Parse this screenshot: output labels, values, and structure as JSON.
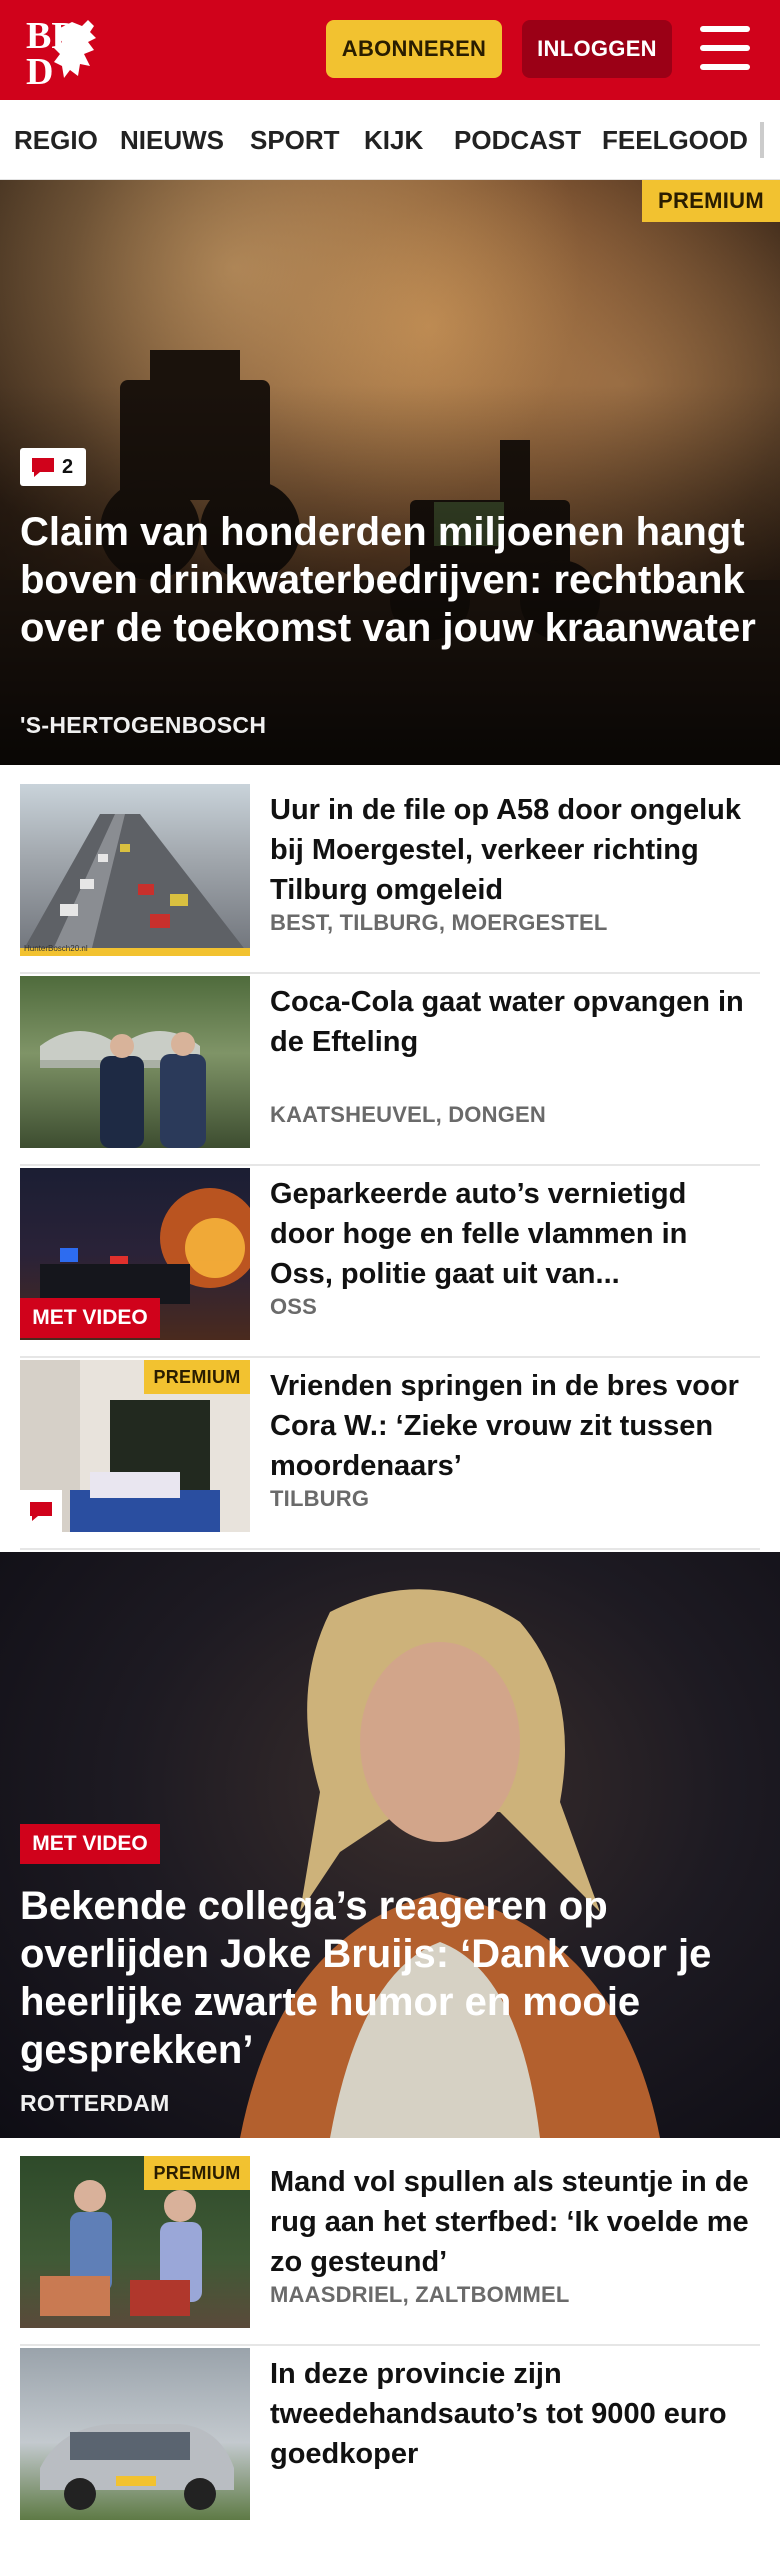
{
  "header": {
    "brand": "BD",
    "subscribe_label": "ABONNEREN",
    "login_label": "INLOGGEN"
  },
  "nav": {
    "items": [
      "REGIO",
      "NIEUWS",
      "SPORT",
      "KIJK",
      "PODCAST",
      "FEELGOOD"
    ]
  },
  "hero": {
    "badge": "PREMIUM",
    "comment_count": "2",
    "title": "Claim van honderden miljoenen hangt boven drinkwaterbedrijven: rechtbank over de toekomst van jouw kraanwater",
    "location": "'S-HERTOGENBOSCH"
  },
  "articles": [
    {
      "title": "Uur in de file op A58 door ongeluk bij Moergestel, verkeer richting Tilburg omgeleid",
      "location": "BEST, TILBURG, MOERGESTEL",
      "thumb_caption": "HunterBosch20.nl"
    },
    {
      "title": "Coca-Cola gaat water opvangen in de Efteling",
      "location": "KAATSHEUVEL, DONGEN"
    },
    {
      "title": "Geparkeerde auto’s vernietigd door hoge en felle vlammen in Oss, politie gaat uit van...",
      "location": "OSS",
      "badge": "MET VIDEO"
    },
    {
      "title": "Vrienden springen in de bres voor Cora W.: ‘Zieke vrouw zit tussen moordenaars’",
      "location": "TILBURG",
      "badge": "PREMIUM"
    }
  ],
  "feature": {
    "badge": "MET VIDEO",
    "title": "Bekende collega’s reageren op overlijden Joke Bruijs: ‘Dank voor je heerlijke zwarte humor en mooie gesprekken’",
    "location": "ROTTERDAM"
  },
  "articles2": [
    {
      "title": "Mand vol spullen als steuntje in de rug aan het sterfbed: ‘Ik voelde me zo gesteund’",
      "location": "MAASDRIEL, ZALTBOMMEL",
      "badge": "PREMIUM"
    },
    {
      "title": "In deze provincie zijn tweedehandsauto’s tot 9000 euro goedkoper",
      "location": ""
    }
  ],
  "colors": {
    "brand_red": "#d0021b",
    "premium_yellow": "#f2c230",
    "login_dark_red": "#9b0016"
  }
}
